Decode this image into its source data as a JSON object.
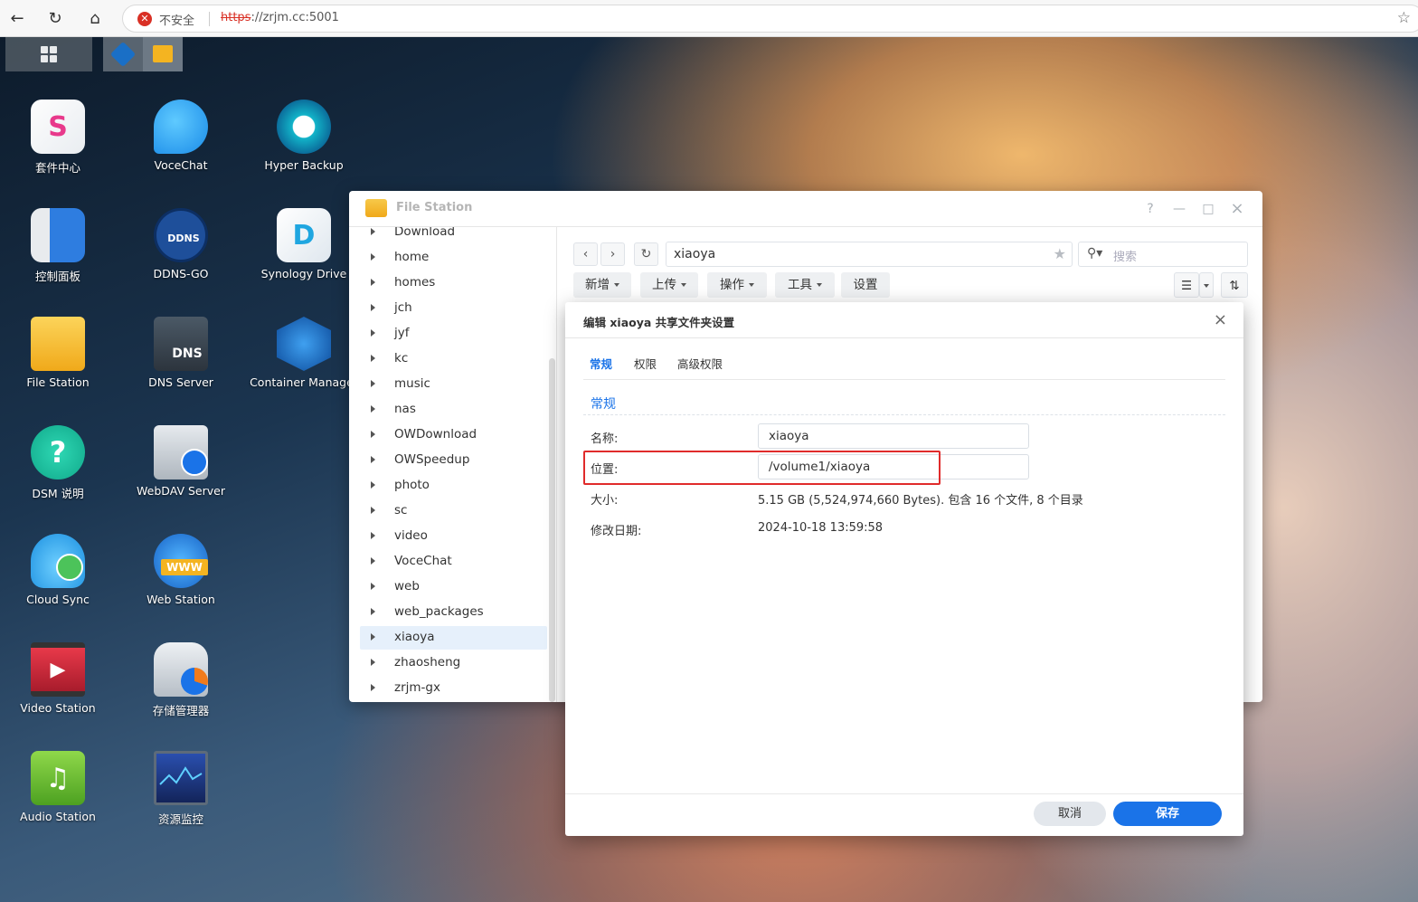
{
  "browser": {
    "insecure_label": "不安全",
    "url_scheme": "https",
    "url_rest": "://zrjm.cc:5001"
  },
  "desktop": {
    "apps": [
      {
        "label": "套件中心",
        "icon": "package-center-icon",
        "color": "#f3f3f3"
      },
      {
        "label": "VoceChat",
        "icon": "vocechat-icon",
        "color": "#2aa6f4"
      },
      {
        "label": "Hyper Backup",
        "icon": "hyper-backup-icon",
        "color": "#10b6c8"
      },
      {
        "label": "控制面板",
        "icon": "control-panel-icon",
        "color": "#2e7de0"
      },
      {
        "label": "DDNS-GO",
        "icon": "ddns-go-icon",
        "color": "#1e4f9a"
      },
      {
        "label": "Synology Drive",
        "icon": "synology-drive-icon",
        "color": "#1fa6e0"
      },
      {
        "label": "File Station",
        "icon": "file-station-icon",
        "color": "#f4b421"
      },
      {
        "label": "DNS Server",
        "icon": "dns-server-icon",
        "color": "#4b5966"
      },
      {
        "label": "Container Manager",
        "icon": "container-manager-icon",
        "color": "#1a6fc6"
      },
      {
        "label": "DSM 说明",
        "icon": "dsm-help-icon",
        "color": "#18c3a0"
      },
      {
        "label": "WebDAV Server",
        "icon": "webdav-server-icon",
        "color": "#b8c0c8"
      },
      {
        "label": "Cloud Sync",
        "icon": "cloud-sync-icon",
        "color": "#2da6e8"
      },
      {
        "label": "Web Station",
        "icon": "web-station-icon",
        "color": "#2f8fe0"
      },
      {
        "label": "Video Station",
        "icon": "video-station-icon",
        "color": "#d8283a"
      },
      {
        "label": "存储管理器",
        "icon": "storage-manager-icon",
        "color": "#c8ced6"
      },
      {
        "label": "Audio Station",
        "icon": "audio-station-icon",
        "color": "#6abe36"
      },
      {
        "label": "资源监控",
        "icon": "resource-monitor-icon",
        "color": "#243b7a"
      }
    ],
    "icon_glyphs": {
      "dns": "DNS",
      "ddns": "DDNS",
      "www": "WWW",
      "help": "?",
      "drive": "D",
      "pkg": "S",
      "music": "♫",
      "play": "▶"
    }
  },
  "file_station": {
    "title": "File Station",
    "window_controls": {
      "help": "?",
      "minimize": "—",
      "maximize": "□",
      "close": "×"
    },
    "tree": [
      {
        "label": "Download"
      },
      {
        "label": "home"
      },
      {
        "label": "homes"
      },
      {
        "label": "jch"
      },
      {
        "label": "jyf"
      },
      {
        "label": "kc"
      },
      {
        "label": "music"
      },
      {
        "label": "nas"
      },
      {
        "label": "OWDownload"
      },
      {
        "label": "OWSpeedup"
      },
      {
        "label": "photo"
      },
      {
        "label": "sc"
      },
      {
        "label": "video"
      },
      {
        "label": "VoceChat"
      },
      {
        "label": "web"
      },
      {
        "label": "web_packages"
      },
      {
        "label": "xiaoya",
        "selected": true
      },
      {
        "label": "zhaosheng"
      },
      {
        "label": "zrjm-gx"
      }
    ],
    "toolbar": {
      "back": "‹",
      "forward": "›",
      "refresh": "↻",
      "path": "xiaoya",
      "search_placeholder": "搜索",
      "create": "新增",
      "upload": "上传",
      "action": "操作",
      "tools": "工具",
      "settings": "设置",
      "view_icon": "☰",
      "sort_icon": "⇅"
    }
  },
  "dialog": {
    "title": "编辑 xiaoya 共享文件夹设置",
    "close": "×",
    "tabs": [
      "常规",
      "权限",
      "高级权限"
    ],
    "active_tab": "常规",
    "section": "常规",
    "fields": {
      "name_label": "名称:",
      "name_value": "xiaoya",
      "location_label": "位置:",
      "location_value": "/volume1/xiaoya",
      "size_label": "大小:",
      "size_value": "5.15 GB (5,524,974,660 Bytes). 包含 16 个文件,  8 个目录",
      "modified_label": "修改日期:",
      "modified_value": "2024-10-18 13:59:58"
    },
    "cancel": "取消",
    "save": "保存",
    "highlight_color": "#e02b2b",
    "accent_color": "#1a73e8"
  }
}
